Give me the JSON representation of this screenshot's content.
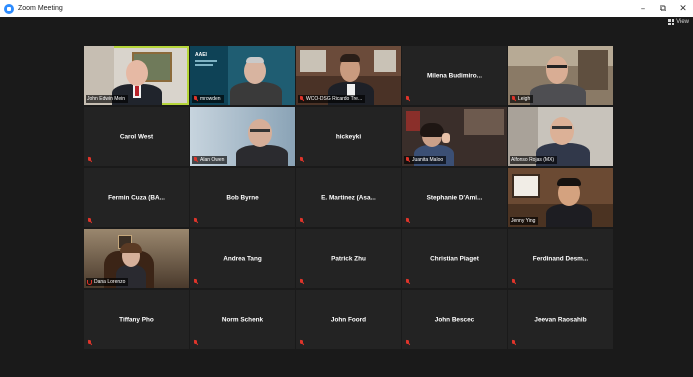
{
  "window": {
    "title": "Zoom Meeting",
    "minimize_glyph": "–",
    "maximize_glyph": "⧉",
    "close_glyph": "✕"
  },
  "toolbar": {
    "view_label": "View"
  },
  "colors": {
    "active_speaker": "#b6d63a",
    "muted_red": "#e0352b",
    "zoom_blue": "#2d8cff"
  },
  "participants": [
    {
      "name": "John Edwin Mein",
      "video": true
    },
    {
      "name": "mrowden",
      "video": true,
      "slide_brand": "AAEI"
    },
    {
      "name": "WCO-DSG Ricardo Tre...",
      "video": true
    },
    {
      "name": "Milena Budimiro...",
      "video": false
    },
    {
      "name": "Leigh",
      "video": true
    },
    {
      "name": "Carol West",
      "video": false
    },
    {
      "name": "Alan Owen",
      "video": true
    },
    {
      "name": "hickeyki",
      "video": false
    },
    {
      "name": "Juanita Maloo",
      "video": true
    },
    {
      "name": "Alfonso Rojas (MX)",
      "video": true
    },
    {
      "name": "Fermin Cuza (BA...",
      "video": false
    },
    {
      "name": "Bob Byrne",
      "video": false
    },
    {
      "name": "E. Martinez (Asa...",
      "video": false
    },
    {
      "name": "Stephanie D'Ami...",
      "video": false
    },
    {
      "name": "Jenny Ying",
      "video": true
    },
    {
      "name": "Dana Lorenzo",
      "video": true
    },
    {
      "name": "Andrea Tang",
      "video": false
    },
    {
      "name": "Patrick Zhu",
      "video": false
    },
    {
      "name": "Christian Piaget",
      "video": false
    },
    {
      "name": "Ferdinand Desm...",
      "video": false
    },
    {
      "name": "Tiffany Pho",
      "video": false
    },
    {
      "name": "Norm Schenk",
      "video": false
    },
    {
      "name": "John Foord",
      "video": false
    },
    {
      "name": "John Bescec",
      "video": false
    },
    {
      "name": "Jeevan Raosahib",
      "video": false
    }
  ]
}
